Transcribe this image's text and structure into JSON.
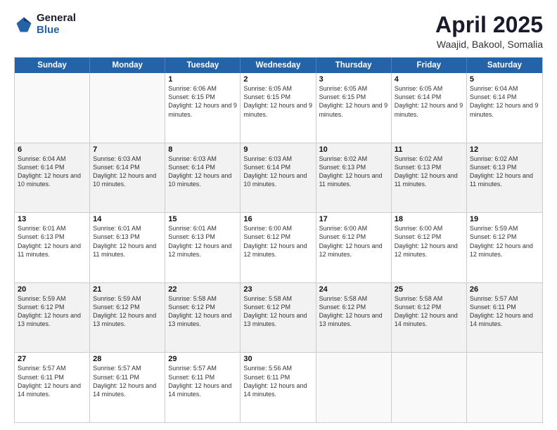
{
  "logo": {
    "general": "General",
    "blue": "Blue"
  },
  "title": "April 2025",
  "subtitle": "Waajid, Bakool, Somalia",
  "calendar": {
    "headers": [
      "Sunday",
      "Monday",
      "Tuesday",
      "Wednesday",
      "Thursday",
      "Friday",
      "Saturday"
    ],
    "rows": [
      [
        {
          "day": "",
          "info": ""
        },
        {
          "day": "",
          "info": ""
        },
        {
          "day": "1",
          "info": "Sunrise: 6:06 AM\nSunset: 6:15 PM\nDaylight: 12 hours and 9 minutes."
        },
        {
          "day": "2",
          "info": "Sunrise: 6:05 AM\nSunset: 6:15 PM\nDaylight: 12 hours and 9 minutes."
        },
        {
          "day": "3",
          "info": "Sunrise: 6:05 AM\nSunset: 6:15 PM\nDaylight: 12 hours and 9 minutes."
        },
        {
          "day": "4",
          "info": "Sunrise: 6:05 AM\nSunset: 6:14 PM\nDaylight: 12 hours and 9 minutes."
        },
        {
          "day": "5",
          "info": "Sunrise: 6:04 AM\nSunset: 6:14 PM\nDaylight: 12 hours and 9 minutes."
        }
      ],
      [
        {
          "day": "6",
          "info": "Sunrise: 6:04 AM\nSunset: 6:14 PM\nDaylight: 12 hours and 10 minutes."
        },
        {
          "day": "7",
          "info": "Sunrise: 6:03 AM\nSunset: 6:14 PM\nDaylight: 12 hours and 10 minutes."
        },
        {
          "day": "8",
          "info": "Sunrise: 6:03 AM\nSunset: 6:14 PM\nDaylight: 12 hours and 10 minutes."
        },
        {
          "day": "9",
          "info": "Sunrise: 6:03 AM\nSunset: 6:14 PM\nDaylight: 12 hours and 10 minutes."
        },
        {
          "day": "10",
          "info": "Sunrise: 6:02 AM\nSunset: 6:13 PM\nDaylight: 12 hours and 11 minutes."
        },
        {
          "day": "11",
          "info": "Sunrise: 6:02 AM\nSunset: 6:13 PM\nDaylight: 12 hours and 11 minutes."
        },
        {
          "day": "12",
          "info": "Sunrise: 6:02 AM\nSunset: 6:13 PM\nDaylight: 12 hours and 11 minutes."
        }
      ],
      [
        {
          "day": "13",
          "info": "Sunrise: 6:01 AM\nSunset: 6:13 PM\nDaylight: 12 hours and 11 minutes."
        },
        {
          "day": "14",
          "info": "Sunrise: 6:01 AM\nSunset: 6:13 PM\nDaylight: 12 hours and 11 minutes."
        },
        {
          "day": "15",
          "info": "Sunrise: 6:01 AM\nSunset: 6:13 PM\nDaylight: 12 hours and 12 minutes."
        },
        {
          "day": "16",
          "info": "Sunrise: 6:00 AM\nSunset: 6:12 PM\nDaylight: 12 hours and 12 minutes."
        },
        {
          "day": "17",
          "info": "Sunrise: 6:00 AM\nSunset: 6:12 PM\nDaylight: 12 hours and 12 minutes."
        },
        {
          "day": "18",
          "info": "Sunrise: 6:00 AM\nSunset: 6:12 PM\nDaylight: 12 hours and 12 minutes."
        },
        {
          "day": "19",
          "info": "Sunrise: 5:59 AM\nSunset: 6:12 PM\nDaylight: 12 hours and 12 minutes."
        }
      ],
      [
        {
          "day": "20",
          "info": "Sunrise: 5:59 AM\nSunset: 6:12 PM\nDaylight: 12 hours and 13 minutes."
        },
        {
          "day": "21",
          "info": "Sunrise: 5:59 AM\nSunset: 6:12 PM\nDaylight: 12 hours and 13 minutes."
        },
        {
          "day": "22",
          "info": "Sunrise: 5:58 AM\nSunset: 6:12 PM\nDaylight: 12 hours and 13 minutes."
        },
        {
          "day": "23",
          "info": "Sunrise: 5:58 AM\nSunset: 6:12 PM\nDaylight: 12 hours and 13 minutes."
        },
        {
          "day": "24",
          "info": "Sunrise: 5:58 AM\nSunset: 6:12 PM\nDaylight: 12 hours and 13 minutes."
        },
        {
          "day": "25",
          "info": "Sunrise: 5:58 AM\nSunset: 6:12 PM\nDaylight: 12 hours and 14 minutes."
        },
        {
          "day": "26",
          "info": "Sunrise: 5:57 AM\nSunset: 6:11 PM\nDaylight: 12 hours and 14 minutes."
        }
      ],
      [
        {
          "day": "27",
          "info": "Sunrise: 5:57 AM\nSunset: 6:11 PM\nDaylight: 12 hours and 14 minutes."
        },
        {
          "day": "28",
          "info": "Sunrise: 5:57 AM\nSunset: 6:11 PM\nDaylight: 12 hours and 14 minutes."
        },
        {
          "day": "29",
          "info": "Sunrise: 5:57 AM\nSunset: 6:11 PM\nDaylight: 12 hours and 14 minutes."
        },
        {
          "day": "30",
          "info": "Sunrise: 5:56 AM\nSunset: 6:11 PM\nDaylight: 12 hours and 14 minutes."
        },
        {
          "day": "",
          "info": ""
        },
        {
          "day": "",
          "info": ""
        },
        {
          "day": "",
          "info": ""
        }
      ]
    ]
  }
}
